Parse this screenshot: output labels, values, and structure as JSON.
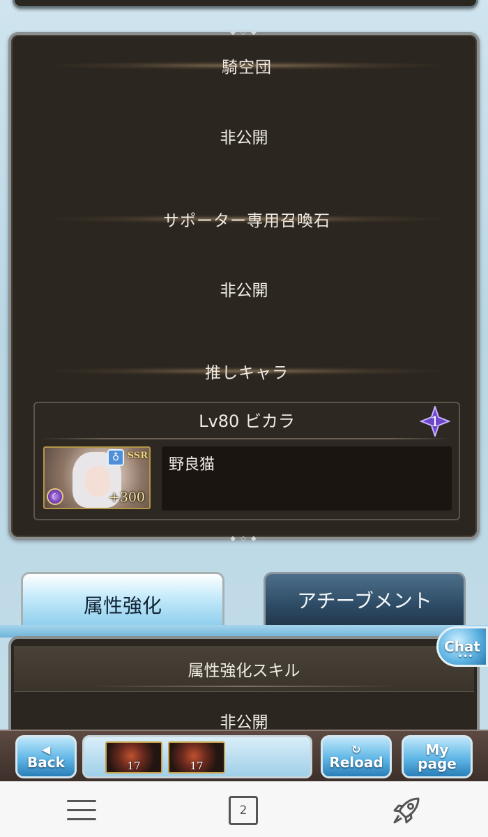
{
  "profile": {
    "crew_label": "騎空団",
    "crew_value": "非公開",
    "support_summon_label": "サポーター専用召喚石",
    "support_summon_value": "非公開",
    "favorite_char_label": "推しキャラ",
    "favorite_char": {
      "title": "Lv80 ビカラ",
      "rank": "1",
      "rarity": "SSR",
      "plus": "+300",
      "element_icon": "water-element-icon",
      "comment": "野良猫"
    }
  },
  "tabs": [
    {
      "label": "属性強化",
      "active": true
    },
    {
      "label": "アチーブメント",
      "active": false
    }
  ],
  "element_skill": {
    "header": "属性強化スキル",
    "value": "非公開"
  },
  "chat": {
    "label": "Chat",
    "dots": "•••"
  },
  "game_nav": {
    "back_label": "Back",
    "reload_label": "Reload",
    "mypage_label_1": "My",
    "mypage_label_2": "page",
    "items": [
      {
        "count": "17"
      },
      {
        "count": "17"
      }
    ]
  },
  "browser": {
    "tab_count": "2"
  }
}
